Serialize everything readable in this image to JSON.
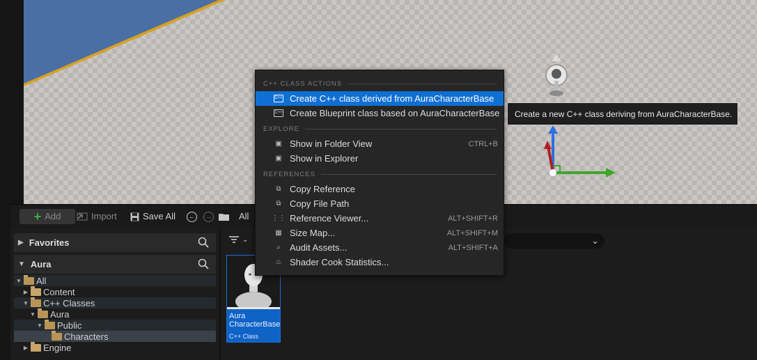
{
  "viewport": {
    "tooltip": "Create a new C++ class deriving from AuraCharacterBase."
  },
  "toolbar": {
    "add_label": "Add",
    "import_label": "Import",
    "save_all_label": "Save All",
    "path_label": "All"
  },
  "tree": {
    "favorites_label": "Favorites",
    "project_label": "Aura",
    "rows": [
      {
        "label": "All"
      },
      {
        "label": "Content"
      },
      {
        "label": "C++ Classes"
      },
      {
        "label": "Aura"
      },
      {
        "label": "Public"
      },
      {
        "label": "Characters"
      },
      {
        "label": "Engine"
      }
    ]
  },
  "asset": {
    "name": "Aura CharacterBase",
    "type": "C++ Class"
  },
  "menu": {
    "sections": [
      {
        "header": "C++ CLASS ACTIONS",
        "items": [
          {
            "label": "Create C++ class derived from AuraCharacterBase",
            "shortcut": "",
            "icon": "cpp-class-icon"
          },
          {
            "label": "Create Blueprint class based on AuraCharacterBase",
            "shortcut": "",
            "icon": "blueprint-class-icon"
          }
        ]
      },
      {
        "header": "EXPLORE",
        "items": [
          {
            "label": "Show in Folder View",
            "shortcut": "CTRL+B",
            "icon": "folder-search-icon"
          },
          {
            "label": "Show in Explorer",
            "shortcut": "",
            "icon": "explorer-icon"
          }
        ]
      },
      {
        "header": "REFERENCES",
        "items": [
          {
            "label": "Copy Reference",
            "shortcut": "",
            "icon": "copy-reference-icon"
          },
          {
            "label": "Copy File Path",
            "shortcut": "",
            "icon": "copy-path-icon"
          },
          {
            "label": "Reference Viewer...",
            "shortcut": "ALT+SHIFT+R",
            "icon": "reference-viewer-icon"
          },
          {
            "label": "Size Map...",
            "shortcut": "ALT+SHIFT+M",
            "icon": "size-map-icon"
          },
          {
            "label": "Audit Assets...",
            "shortcut": "ALT+SHIFT+A",
            "icon": "audit-icon"
          },
          {
            "label": "Shader Cook Statistics...",
            "shortcut": "",
            "icon": "shader-stats-icon"
          }
        ]
      }
    ]
  }
}
